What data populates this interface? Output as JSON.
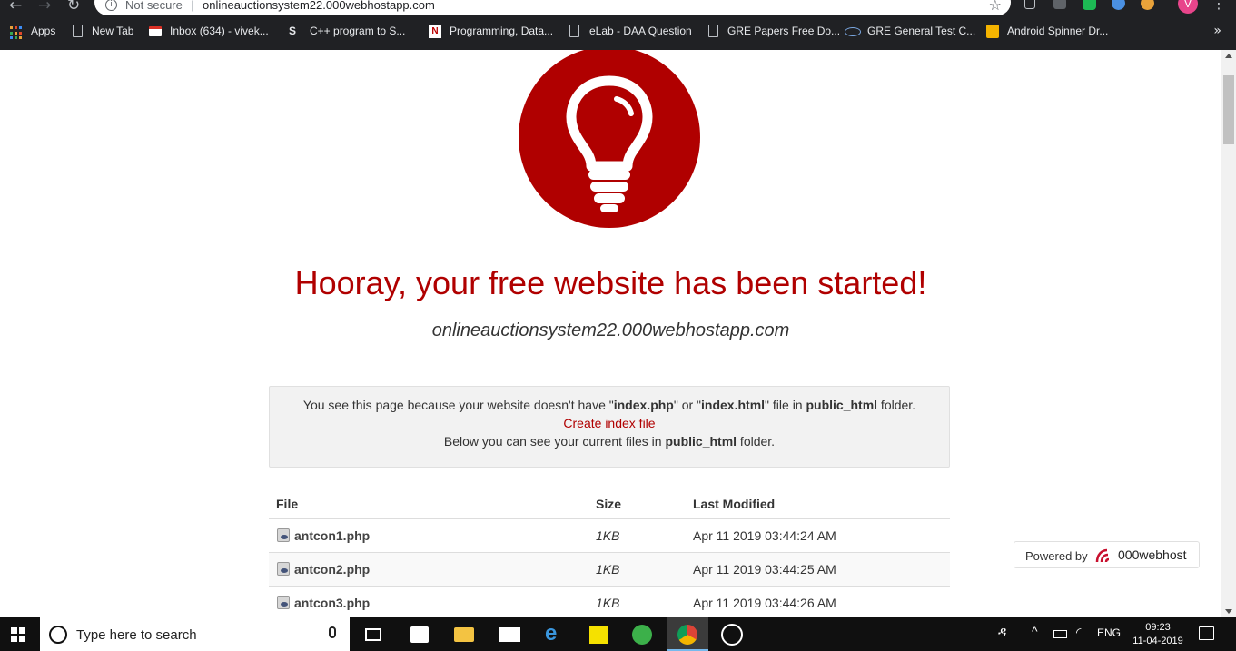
{
  "browser": {
    "security_label": "Not secure",
    "separator": "|",
    "url": "onlineauctionsystem22.000webhostapp.com",
    "avatar_letter": "V",
    "bookmarks": [
      {
        "label": "Apps",
        "icon": "apps-grid-icon"
      },
      {
        "label": "New Tab",
        "icon": "document-icon"
      },
      {
        "label": "Inbox (634) - vivek...",
        "icon": "gmail-icon"
      },
      {
        "label": "C++ program to S...",
        "icon": "s-logo-icon"
      },
      {
        "label": "Programming, Data...",
        "icon": "n-logo-icon"
      },
      {
        "label": "eLab - DAA Question",
        "icon": "document-icon"
      },
      {
        "label": "GRE Papers Free Do...",
        "icon": "document-icon"
      },
      {
        "label": "GRE General Test C...",
        "icon": "ets-logo-icon"
      },
      {
        "label": "Android Spinner Dr...",
        "icon": "yellow-square-icon"
      }
    ],
    "more_glyph": "»"
  },
  "page": {
    "headline": "Hooray, your free website has been started!",
    "domain": "onlineauctionsystem22.000webhostapp.com",
    "notice": {
      "line1_pre": "You see this page because your website doesn't have \"",
      "index_php": "index.php",
      "line1_mid": "\" or \"",
      "index_html": "index.html",
      "line1_post_a": "\" file in ",
      "public_html": "public_html",
      "line1_post_b": " folder.",
      "create_link": "Create index file",
      "line3_pre": "Below you can see your current files in ",
      "line3_folder": "public_html",
      "line3_post": " folder."
    },
    "table": {
      "headers": {
        "file": "File",
        "size": "Size",
        "modified": "Last Modified"
      },
      "rows": [
        {
          "file": "antcon1.php",
          "size": "1KB",
          "modified": "Apr 11 2019 03:44:24 AM"
        },
        {
          "file": "antcon2.php",
          "size": "1KB",
          "modified": "Apr 11 2019 03:44:25 AM"
        },
        {
          "file": "antcon3.php",
          "size": "1KB",
          "modified": "Apr 11 2019 03:44:26 AM"
        }
      ]
    },
    "powered": {
      "label": "Powered by",
      "brand": "000webhost"
    },
    "colors": {
      "brand_red": "#b00000"
    }
  },
  "taskbar": {
    "search_placeholder": "Type here to search",
    "language": "ENG",
    "time": "09:23",
    "date": "11-04-2019"
  }
}
